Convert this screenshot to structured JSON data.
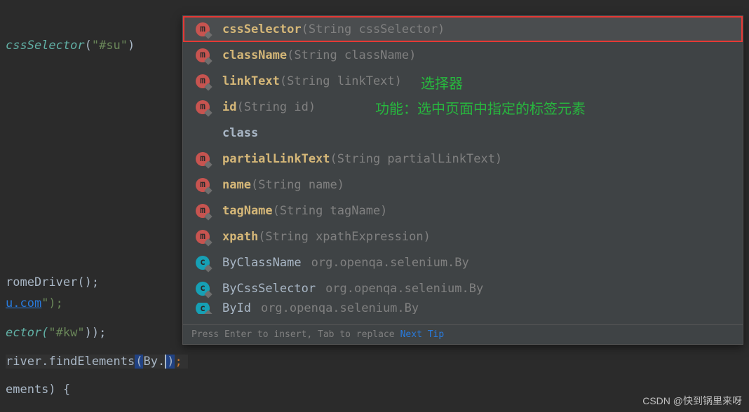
{
  "code": {
    "line1_method": "cssSelector",
    "line1_arg": "\"#su\"",
    "line_rome": "romeDriver();",
    "line_ucom_pre": "u.com",
    "line_ucom_post": "\");",
    "line_ector_pre": "ector(",
    "line_ector_arg": "\"#kw\"",
    "line_ector_post": "));",
    "line_river_pre": "river.findElements",
    "line_river_paren": "(",
    "line_river_by": "By.",
    "line_river_close": ");",
    "line_ements": "ements) {"
  },
  "popup": {
    "items": [
      {
        "icon": "m",
        "name": "cssSelector",
        "params": "(String cssSelector)",
        "selected": true
      },
      {
        "icon": "m",
        "name": "className",
        "params": "(String className)"
      },
      {
        "icon": "m",
        "name": "linkText",
        "params": "(String linkText)"
      },
      {
        "icon": "m",
        "name": "id",
        "params": "(String id)"
      },
      {
        "icon": "",
        "name": "class",
        "params": "",
        "noicon": true
      },
      {
        "icon": "m",
        "name": "partialLinkText",
        "params": "(String partialLinkText)"
      },
      {
        "icon": "m",
        "name": "name",
        "params": "(String name)"
      },
      {
        "icon": "m",
        "name": "tagName",
        "params": "(String tagName)"
      },
      {
        "icon": "m",
        "name": "xpath",
        "params": "(String xpathExpression)"
      },
      {
        "icon": "c",
        "name": "ByClassName",
        "package": "org.openqa.selenium.By"
      },
      {
        "icon": "c",
        "name": "ByCssSelector",
        "package": "org.openqa.selenium.By"
      },
      {
        "icon": "c",
        "name": "ById",
        "package": "org.openqa.selenium.By",
        "partial": true
      }
    ],
    "footer_text": "Press Enter to insert, Tab to replace",
    "footer_link": "Next Tip"
  },
  "annotations": {
    "a1": "选择器",
    "a2": "功能：选中页面中指定的标签元素"
  },
  "watermark": "CSDN @快到锅里来呀"
}
